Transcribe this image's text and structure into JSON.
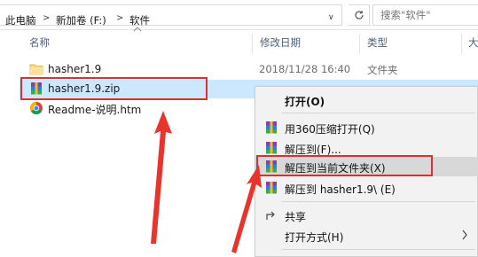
{
  "address": {
    "crumbs": [
      "此电脑",
      "新加卷 (F:)",
      "软件"
    ],
    "separator": ">",
    "dropdown": "∨",
    "search_placeholder": "搜索\"软件\""
  },
  "columns": {
    "name": "名称",
    "date": "修改日期",
    "type": "类型",
    "size": "大"
  },
  "files": [
    {
      "name": "hasher1.9",
      "date": "2018/11/28 16:40",
      "type": "文件夹",
      "icon": "folder-icon"
    },
    {
      "name": "hasher1.9.zip",
      "date": "",
      "type": "",
      "icon": "winrar-archive-icon",
      "selected": true
    },
    {
      "name": "Readme-说明.htm",
      "date": "",
      "type": "",
      "icon": "chrome-html-icon"
    }
  ],
  "context_menu": {
    "items": [
      {
        "label": "打开(O)",
        "bold": true,
        "icon": ""
      },
      {
        "label": "用360压缩打开(Q)",
        "icon": "archive-icon"
      },
      {
        "label": "解压到(F)...",
        "icon": "archive-icon"
      },
      {
        "label": "解压到当前文件夹(X)",
        "icon": "archive-icon",
        "highlighted": true
      },
      {
        "label": "解压到 hasher1.9\\ (E)",
        "icon": "archive-icon"
      },
      {
        "label": "共享",
        "icon": "share-icon"
      },
      {
        "label": "打开方式(H)",
        "icon": "",
        "submenu": true
      }
    ]
  },
  "colors": {
    "selection": "#cce8ff",
    "highlight_box": "#e02d2d",
    "menu_background": "#f2f2f2"
  }
}
